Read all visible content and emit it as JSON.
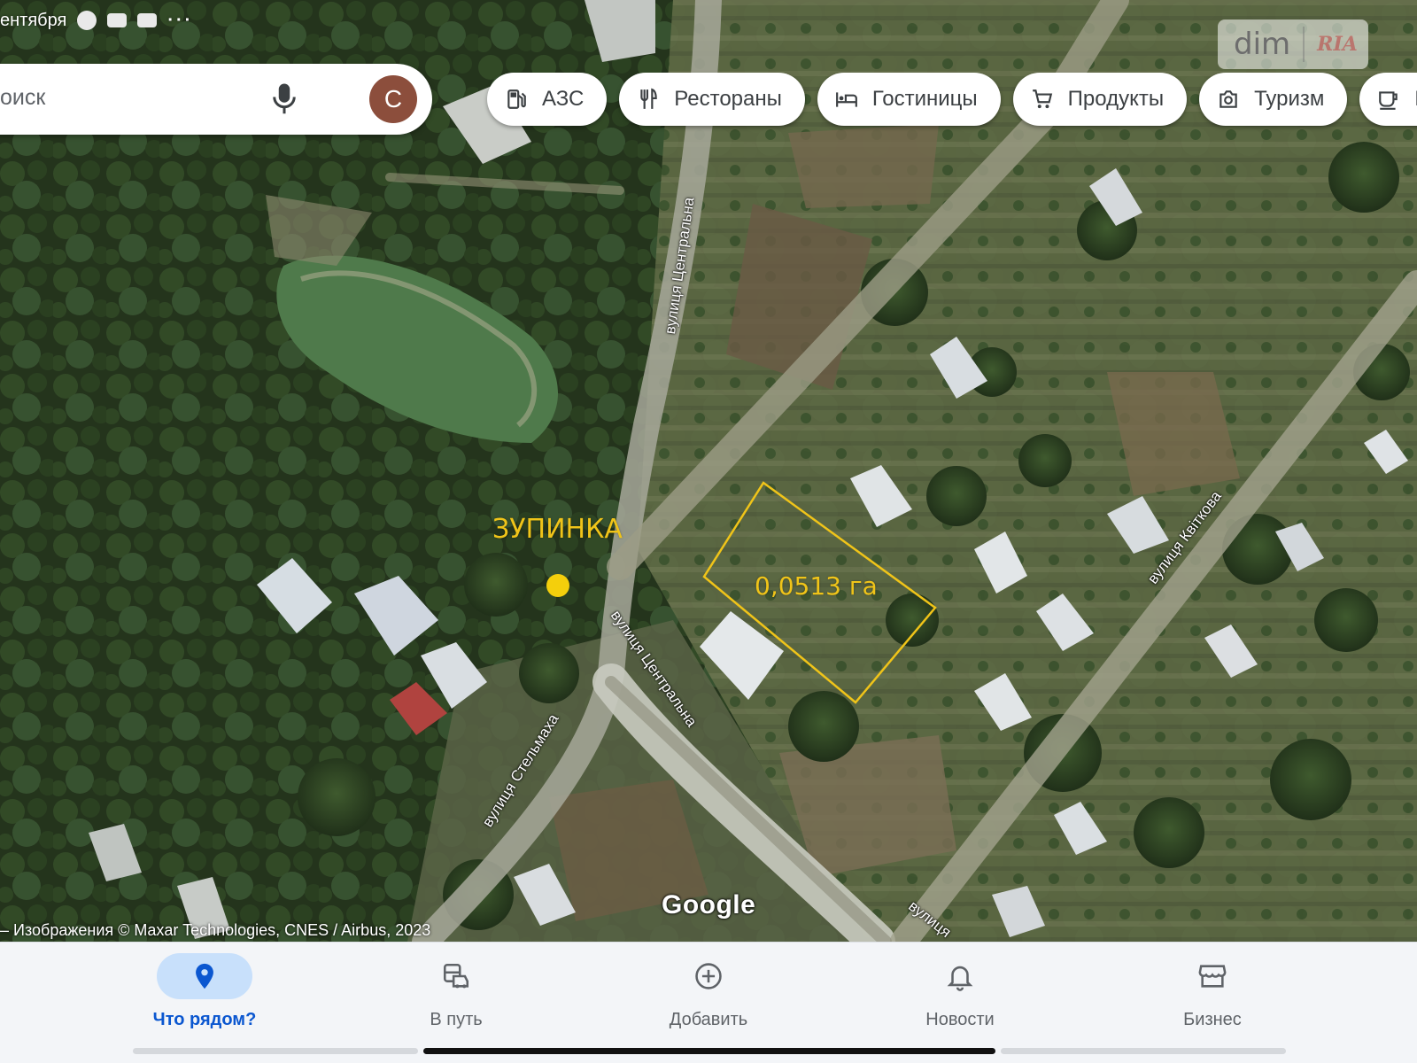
{
  "status_bar": {
    "date_text": "ентября",
    "more": "···"
  },
  "logo": {
    "text": "dim",
    "ria": "RIA"
  },
  "search": {
    "placeholder": "оиск",
    "avatar_letter": "С"
  },
  "chips": [
    {
      "label": "АЗС",
      "icon": "gas-station-icon"
    },
    {
      "label": "Рестораны",
      "icon": "restaurant-icon"
    },
    {
      "label": "Гостиницы",
      "icon": "hotel-icon"
    },
    {
      "label": "Продукты",
      "icon": "cart-icon"
    },
    {
      "label": "Туризм",
      "icon": "camera-icon"
    },
    {
      "label": "Ко",
      "icon": "coffee-icon"
    }
  ],
  "map": {
    "stop_label": "ЗУПИНКА",
    "plot_label": "0,0513 га",
    "streets": [
      "вулиця Центральна",
      "вулиця Центральна",
      "вулиця Стельмаха",
      "вулиця Квіткова",
      "вулиця"
    ],
    "google_label": "Google",
    "attribution": "– Изображения © Maxar Technologies, CNES / Airbus, 2023",
    "overlay_color": "#f0c419"
  },
  "nav": [
    {
      "label": "Что рядом?",
      "icon": "location-pin-icon",
      "active": true
    },
    {
      "label": "В путь",
      "icon": "commute-icon",
      "active": false
    },
    {
      "label": "Добавить",
      "icon": "add-circle-icon",
      "active": false
    },
    {
      "label": "Новости",
      "icon": "bell-icon",
      "active": false
    },
    {
      "label": "Бизнес",
      "icon": "storefront-icon",
      "active": false
    }
  ]
}
